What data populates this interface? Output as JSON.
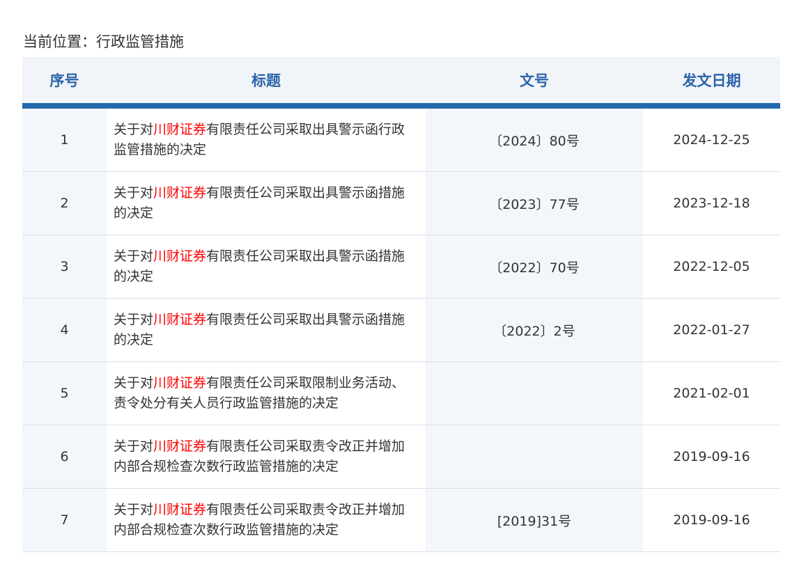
{
  "breadcrumb": "当前位置：行政监管措施",
  "table": {
    "headers": [
      "序号",
      "标题",
      "文号",
      "发文日期"
    ],
    "rows": [
      {
        "no": "1",
        "title_prefix": "关于对",
        "title_highlight": "川财证券",
        "title_suffix": "有限责任公司采取出具警示函行政监管措施的决定",
        "doc_no": "〔2024〕80号",
        "date": "2024-12-25"
      },
      {
        "no": "2",
        "title_prefix": "关于对",
        "title_highlight": "川财证券",
        "title_suffix": "有限责任公司采取出具警示函措施的决定",
        "doc_no": "〔2023〕77号",
        "date": "2023-12-18"
      },
      {
        "no": "3",
        "title_prefix": "关于对",
        "title_highlight": "川财证券",
        "title_suffix": "有限责任公司采取出具警示函措施的决定",
        "doc_no": "〔2022〕70号",
        "date": "2022-12-05"
      },
      {
        "no": "4",
        "title_prefix": "关于对",
        "title_highlight": "川财证券",
        "title_suffix": "有限责任公司采取出具警示函措施的决定",
        "doc_no": "〔2022〕2号",
        "date": "2022-01-27"
      },
      {
        "no": "5",
        "title_prefix": "关于对",
        "title_highlight": "川财证券",
        "title_suffix": "有限责任公司采取限制业务活动、责令处分有关人员行政监管措施的决定",
        "doc_no": "",
        "date": "2021-02-01"
      },
      {
        "no": "6",
        "title_prefix": "关于对",
        "title_highlight": "川财证券",
        "title_suffix": "有限责任公司采取责令改正并增加内部合规检查次数行政监管措施的决定",
        "doc_no": "",
        "date": "2019-09-16"
      },
      {
        "no": "7",
        "title_prefix": "关于对",
        "title_highlight": "川财证券",
        "title_suffix": "有限责任公司采取责令改正并增加内部合规检查次数行政监管措施的决定",
        "doc_no": "[2019]31号",
        "date": "2019-09-16"
      }
    ]
  }
}
